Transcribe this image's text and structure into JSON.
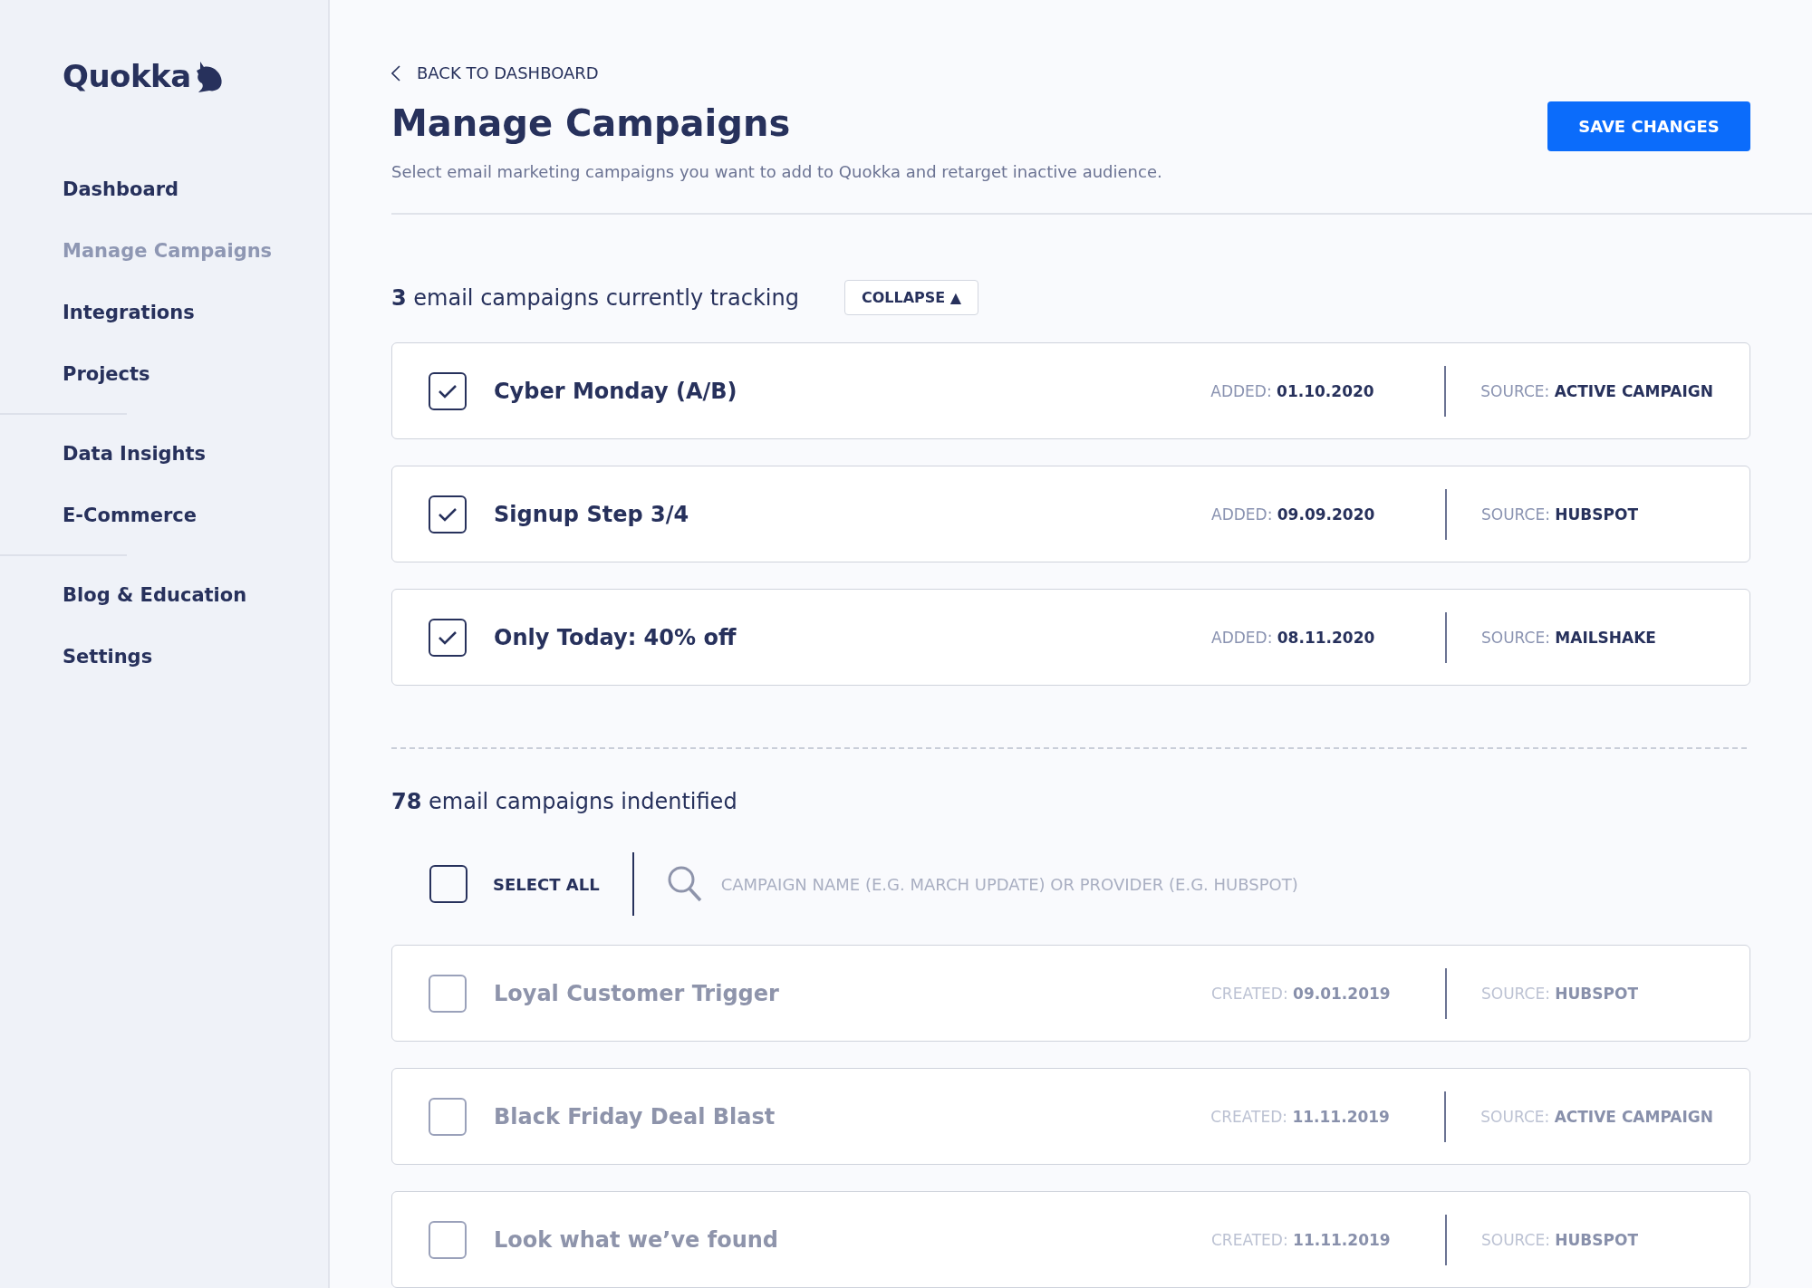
{
  "sidebar": {
    "logo": "Quokka",
    "groups": [
      {
        "items": [
          {
            "label": "Dashboard",
            "selected": false
          },
          {
            "label": "Manage Campaigns",
            "selected": true
          },
          {
            "label": "Integrations",
            "selected": false
          },
          {
            "label": "Projects",
            "selected": false
          }
        ]
      },
      {
        "items": [
          {
            "label": "Data Insights",
            "selected": false
          },
          {
            "label": "E-Commerce",
            "selected": false
          }
        ]
      },
      {
        "items": [
          {
            "label": "Blog & Education",
            "selected": false
          },
          {
            "label": "Settings",
            "selected": false
          }
        ]
      }
    ]
  },
  "header": {
    "back_link": "BACK TO DASHBOARD",
    "title": "Manage Campaigns",
    "subtitle": "Select email marketing campaigns you want to add to Quokka and retarget inactive audience.",
    "save_button": "SAVE CHANGES"
  },
  "tracking": {
    "count": "3",
    "heading": "email campaigns currently tracking",
    "collapse_button": "COLLAPSE ▲",
    "campaigns": [
      {
        "name": "Cyber Monday (A/B)",
        "checked": true,
        "date_label": "ADDED:",
        "date": "01.10.2020",
        "source_label": "SOURCE:",
        "source": "ACTIVE CAMPAIGN"
      },
      {
        "name": "Signup Step 3/4",
        "checked": true,
        "date_label": "ADDED:",
        "date": "09.09.2020",
        "source_label": "SOURCE:",
        "source": "HUBSPOT"
      },
      {
        "name": "Only Today: 40% off",
        "checked": true,
        "date_label": "ADDED:",
        "date": "08.11.2020",
        "source_label": "SOURCE:",
        "source": "MAILSHAKE"
      }
    ]
  },
  "identified": {
    "count": "78",
    "heading": "email campaigns indentified",
    "select_all": {
      "label": "SELECT ALL",
      "checked": false
    },
    "search": {
      "placeholder": "CAMPAIGN NAME (E.G. MARCH UPDATE) OR PROVIDER (E.G. HUBSPOT)"
    },
    "campaigns": [
      {
        "name": "Loyal Customer Trigger",
        "checked": false,
        "date_label": "CREATED:",
        "date": "09.01.2019",
        "source_label": "SOURCE:",
        "source": "HUBSPOT"
      },
      {
        "name": "Black Friday Deal Blast",
        "checked": false,
        "date_label": "CREATED:",
        "date": "11.11.2019",
        "source_label": "SOURCE:",
        "source": "ACTIVE CAMPAIGN"
      },
      {
        "name": "Look what we’ve found",
        "checked": false,
        "date_label": "CREATED:",
        "date": "11.11.2019",
        "source_label": "SOURCE:",
        "source": "HUBSPOT"
      }
    ]
  }
}
